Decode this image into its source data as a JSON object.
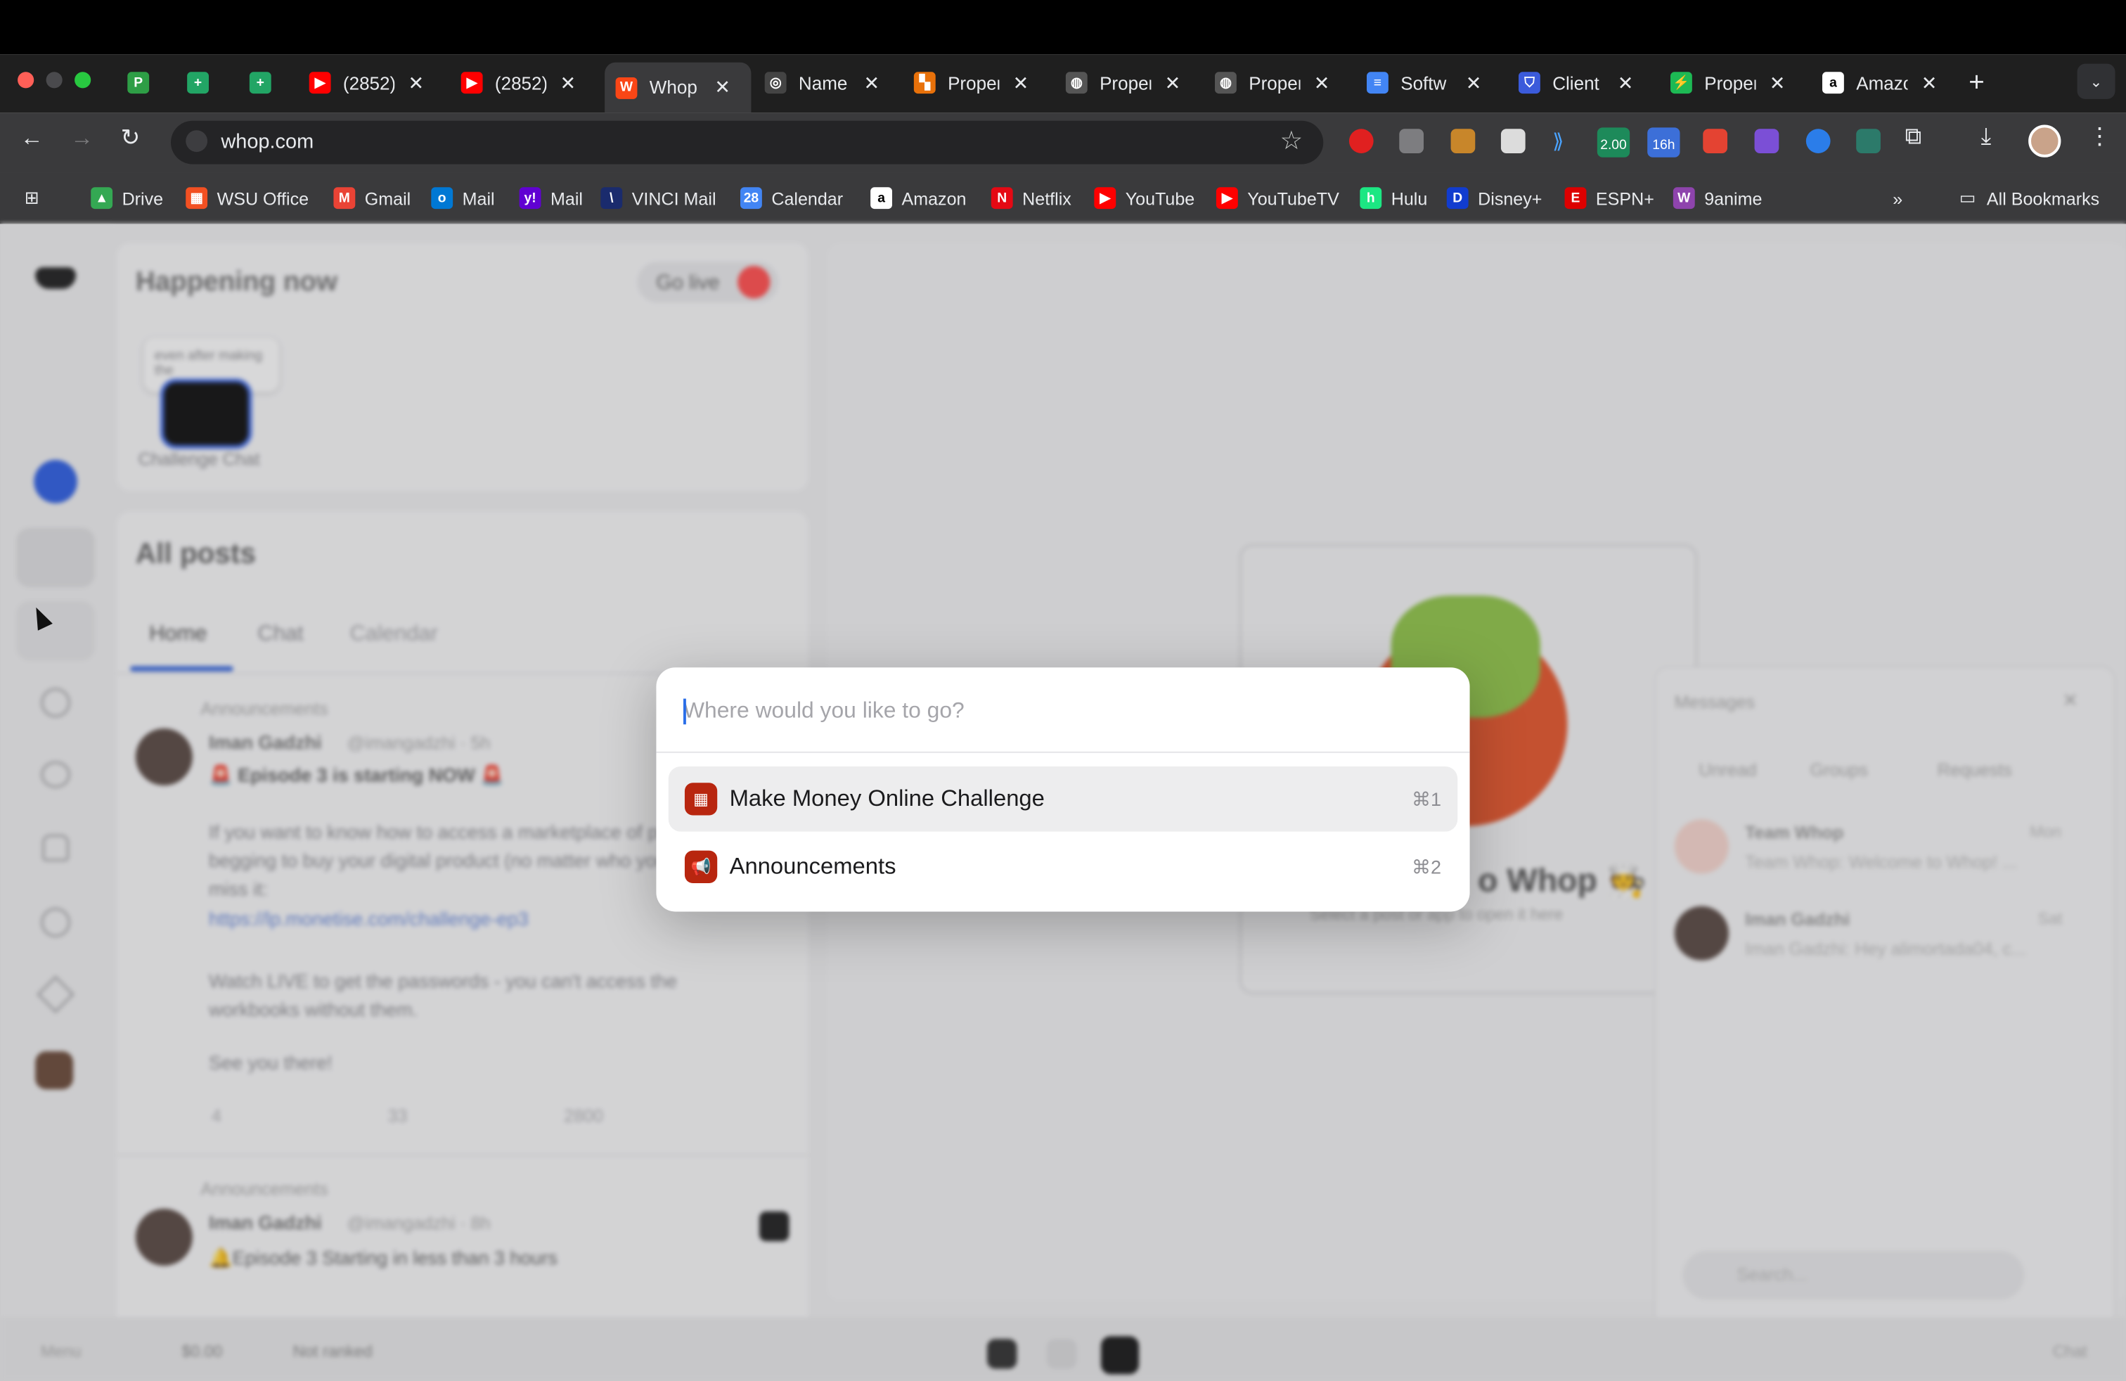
{
  "tabs": [
    {
      "title": "",
      "favicon": "P",
      "color": "#2e9e46"
    },
    {
      "title": "",
      "favicon": "+",
      "color": "#22a565"
    },
    {
      "title": "",
      "favicon": "+",
      "color": "#22a565"
    },
    {
      "title": "(2852)",
      "favicon": "▶",
      "color": "#ff0000"
    },
    {
      "title": "(2852)",
      "favicon": "▶",
      "color": "#ff0000"
    },
    {
      "title": "Whop",
      "favicon": "W",
      "color": "#fa4616",
      "active": true
    },
    {
      "title": "Name",
      "favicon": "◎",
      "color": "#444"
    },
    {
      "title": "Proper",
      "favicon": "▚",
      "color": "#e8710a"
    },
    {
      "title": "Proper",
      "favicon": "◍",
      "color": "#555"
    },
    {
      "title": "Proper",
      "favicon": "◍",
      "color": "#555"
    },
    {
      "title": "Softw",
      "favicon": "≡",
      "color": "#4285f4"
    },
    {
      "title": "Client",
      "favicon": "⛉",
      "color": "#3b5bdb"
    },
    {
      "title": "Proper",
      "favicon": "⚡",
      "color": "#1db954"
    },
    {
      "title": "Amazo",
      "favicon": "a",
      "color": "#fff"
    }
  ],
  "tab_close": "✕",
  "new_tab": "+",
  "tab_menu": "⌄",
  "address": {
    "url": "whop.com"
  },
  "bookmarks": [
    {
      "label": "Drive",
      "color": "#34a853",
      "glyph": "▲"
    },
    {
      "label": "WSU Office",
      "color": "#f25022",
      "glyph": "▦"
    },
    {
      "label": "Gmail",
      "color": "#ea4335",
      "glyph": "M"
    },
    {
      "label": "Mail",
      "color": "#0078d4",
      "glyph": "o"
    },
    {
      "label": "Mail",
      "color": "#6001d2",
      "glyph": "y!"
    },
    {
      "label": "VINCI Mail",
      "color": "#1a2b6d",
      "glyph": "\\"
    },
    {
      "label": "Calendar",
      "color": "#4285f4",
      "glyph": "28"
    },
    {
      "label": "Amazon",
      "color": "#fff",
      "glyph": "a"
    },
    {
      "label": "Netflix",
      "color": "#e50914",
      "glyph": "N"
    },
    {
      "label": "YouTube",
      "color": "#ff0000",
      "glyph": "▶"
    },
    {
      "label": "YouTubeTV",
      "color": "#ff0000",
      "glyph": "▶"
    },
    {
      "label": "Hulu",
      "color": "#1ce783",
      "glyph": "h"
    },
    {
      "label": "Disney+",
      "color": "#113ccf",
      "glyph": "D"
    },
    {
      "label": "ESPN+",
      "color": "#d00",
      "glyph": "E"
    },
    {
      "label": "9anime",
      "color": "#8e44ad",
      "glyph": "W"
    }
  ],
  "bookmarks_more": "»",
  "all_bookmarks": "All Bookmarks",
  "extensions": {
    "badge1": "2.00",
    "badge2": "16h"
  },
  "background": {
    "happening": "Happening now",
    "go_live": "Go live",
    "story_caption": "even after making the",
    "story_label": "Challenge Chat",
    "all_posts": "All posts",
    "feed_tabs": [
      "Home",
      "Chat",
      "Calendar"
    ],
    "post_channel": "Announcements",
    "post_author": "Iman Gadzhi",
    "post_handle": "@imangadzhi · 5h",
    "post_title": "🚨 Episode 3 is starting NOW 🚨",
    "post_body": "If you want to know how to access a marketplace of people begging to buy your digital product (no matter who you are), don't miss it:",
    "post_link": "https://lp.monetise.com/challenge-ep3",
    "post_body2": "Watch LIVE to get the passwords - you can't access the workbooks without them.",
    "post_body3": "See you there!",
    "post_counts": [
      "4",
      "33",
      "2800"
    ],
    "post2_channel": "Announcements",
    "post2_author": "Iman Gadzhi",
    "post2_handle": "@imangadzhi · 8h",
    "post2_title": "🔔Episode 3 Starting in less than 3 hours",
    "welcome": "o Whop 🧑‍🍳",
    "welcome_sub": "Select a post or app to open it here",
    "messages_title": "Messages",
    "msg_tabs": [
      "Unread",
      "Groups",
      "Requests"
    ],
    "msg1_name": "Team Whop",
    "msg1_preview": "Team Whop: Welcome to Whop! ...",
    "msg1_time": "Mon",
    "msg2_name": "Iman Gadzhi",
    "msg2_preview": "Iman Gadzhi: Hey alimortada04, c...",
    "msg2_time": "Sat",
    "search_placeholder": "Search...",
    "bottom_menu": "Menu",
    "bottom_money": "$0.00",
    "bottom_rank": "Not ranked",
    "bottom_chat": "Chat"
  },
  "palette": {
    "placeholder": "Where would you like to go?",
    "items": [
      {
        "label": "Make Money Online Challenge",
        "shortcut": "⌘1",
        "icon": "calendar-icon",
        "color": "#b8260f"
      },
      {
        "label": "Announcements",
        "shortcut": "⌘2",
        "icon": "megaphone-icon",
        "color": "#b8260f"
      }
    ]
  }
}
